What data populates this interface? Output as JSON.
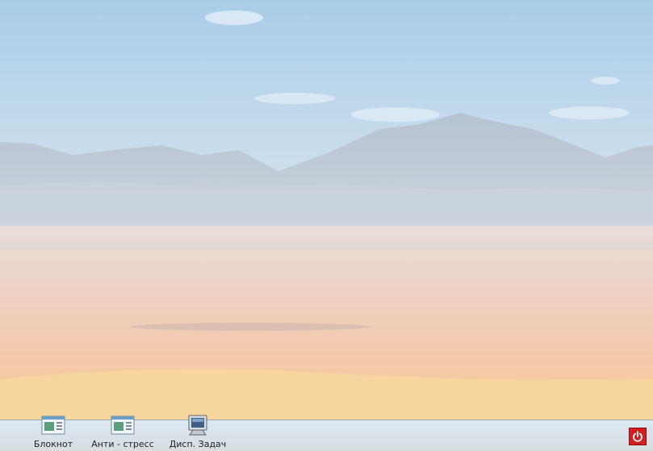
{
  "taskbar": {
    "items": [
      {
        "label": "Блокнот",
        "icon": "notepad-icon"
      },
      {
        "label": "Анти - стресс",
        "icon": "notepad-icon"
      },
      {
        "label": "Дисп. Задач",
        "icon": "monitor-icon"
      }
    ],
    "power_icon": "power-icon"
  },
  "colors": {
    "sky": "#c9dcec",
    "mountains": "#aebdcc",
    "desert": "#f2c9a8",
    "power_button": "#d21f1f"
  }
}
